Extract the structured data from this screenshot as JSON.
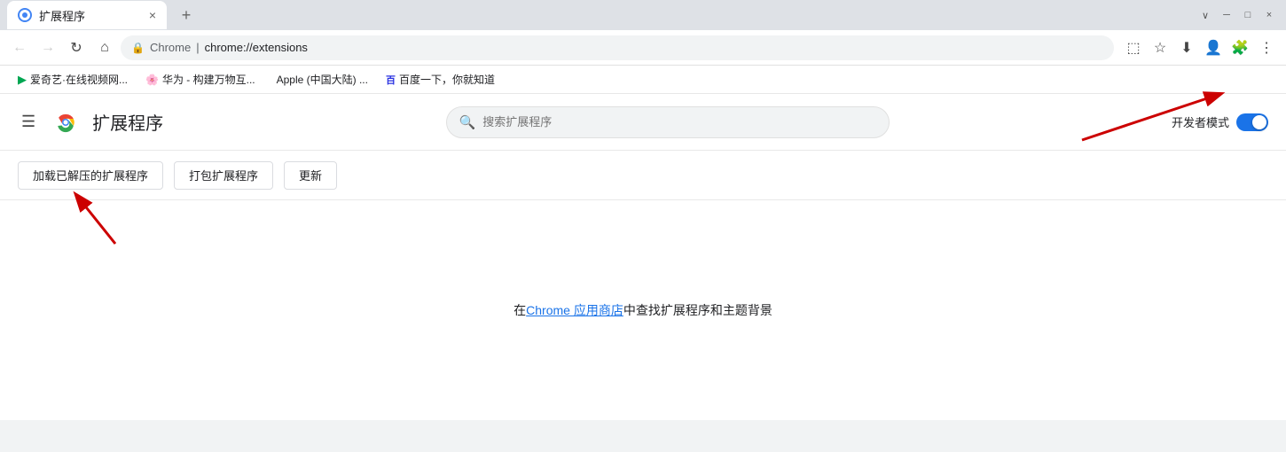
{
  "browser": {
    "tab_title": "扩展程序",
    "tab_close": "×",
    "new_tab": "+",
    "address_brand": "Chrome",
    "address_separator": "|",
    "address_url": "chrome://extensions",
    "nav_back": "←",
    "nav_forward": "→",
    "nav_refresh": "↻",
    "nav_home": "⌂",
    "window_minimize": "─",
    "window_maximize": "□",
    "window_close": "×",
    "chevron": "∨"
  },
  "bookmarks": [
    {
      "label": "爱奇艺·在线视频网..."
    },
    {
      "label": "华为 - 构建万物互..."
    },
    {
      "label": "Apple (中国大陆) ..."
    },
    {
      "label": "百度一下，你就知道"
    }
  ],
  "extensions_page": {
    "menu_icon": "☰",
    "title": "扩展程序",
    "search_placeholder": "搜索扩展程序",
    "developer_mode_label": "开发者模式",
    "load_unpacked_btn": "加载已解压的扩展程序",
    "pack_btn": "打包扩展程序",
    "update_btn": "更新",
    "empty_text_before": "在 ",
    "empty_link": "Chrome 应用商店",
    "empty_text_after": "中查找扩展程序和主题背景"
  }
}
